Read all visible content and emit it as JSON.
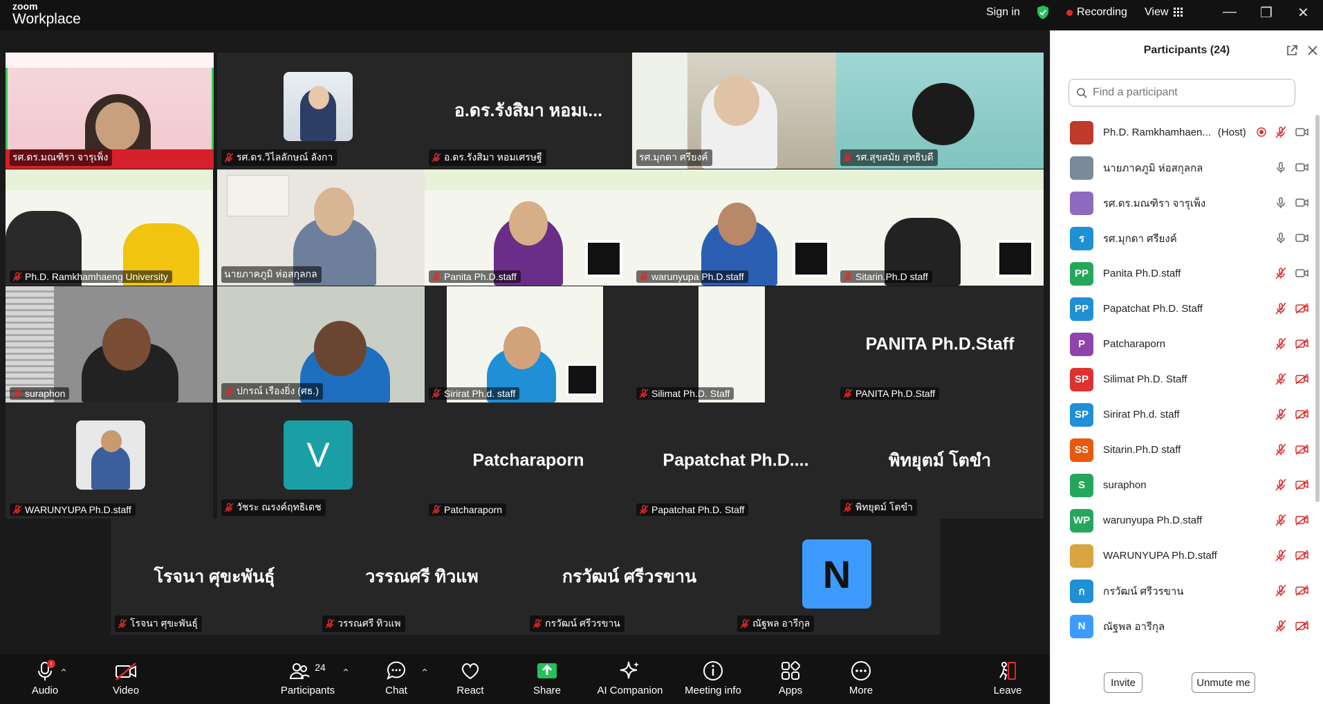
{
  "app": {
    "brand_top": "zoom",
    "brand_bottom": "Workplace"
  },
  "topbar": {
    "sign_in": "Sign in",
    "recording": "Recording",
    "view": "View"
  },
  "tiles": {
    "t1": "รศ.ดร.มณฑิรา จารุเพ็ง",
    "t2": "รศ.ดร.วิไลลักษณ์ ลังกา",
    "t3": "อ.ดร.รังสิมา หอมเศรษฐี",
    "t3_big": "อ.ดร.รังสิมา หอมเ...",
    "t4": "รศ.มุกดา ศรียงค์",
    "t5": "รศ.สุขสมัย สุทธิบดี",
    "t6": "Ph.D. Ramkhamhaeng University",
    "t7": "นายภาคภูมิ ห่อสกุลกล",
    "t8": "Panita Ph.D.staff",
    "t9": "warunyupa Ph.D.staff",
    "t10": "Sitarin.Ph.D staff",
    "t11": "suraphon",
    "t12": "ปกรณ์ เรืองยิ่ง (ศธ.)",
    "t13": "Sirirat Ph.d. staff",
    "t14": "Silimat Ph.D. Staff",
    "t15": "PANITA Ph.D.Staff",
    "t15_big": "PANITA Ph.D.Staff",
    "t16": "WARUNYUPA Ph.D.staff",
    "t17": "วัชระ ณรงค์ฤทธิเดช",
    "t17_avatar": "V",
    "t18": "Patcharaporn",
    "t18_big": "Patcharaporn",
    "t19": "Papatchat Ph.D. Staff",
    "t19_big": "Papatchat  Ph.D....",
    "t20": "พิทยุตม์ โตขำ",
    "t20_big": "พิทยุตม์ โตขำ",
    "t21": "โรจนา ศุขะพันธุ์",
    "t21_big": "โรจนา  ศุขะพันธุ์",
    "t22": "วรรณศรี ทิวแพ",
    "t22_big": "วรรณศรี  ทิวแพ",
    "t23": "กรวัฒน์ ศรีวรขาน",
    "t23_big": "กรวัฒน์ ศรีวรขาน",
    "t24": "ณัฐพล อารีกุล",
    "t24_avatar": "N"
  },
  "toolbar": {
    "audio": "Audio",
    "audio_badge": "!",
    "video": "Video",
    "participants": "Participants",
    "participants_count": "24",
    "chat": "Chat",
    "react": "React",
    "share": "Share",
    "ai": "AI Companion",
    "meeting_info": "Meeting info",
    "apps": "Apps",
    "more": "More",
    "leave": "Leave"
  },
  "panel": {
    "title": "Participants (24)",
    "search_placeholder": "Find a participant",
    "host_tag": "(Host)",
    "invite": "Invite",
    "unmute_me": "Unmute me",
    "participants": [
      {
        "name": "Ph.D. Ramkhamhaen...",
        "avatar": "",
        "color": "#c0392b"
      },
      {
        "name": "นายภาคภูมิ ห่อสกุลกล",
        "avatar": "",
        "color": "#7b8a99"
      },
      {
        "name": "รศ.ดร.มณฑิรา จารุเพ็ง",
        "avatar": "",
        "color": "#8e6bbf"
      },
      {
        "name": "รศ.มุกดา ศรียงค์",
        "avatar": "ร",
        "color": "#1f8fd6"
      },
      {
        "name": "Panita Ph.D.staff",
        "avatar": "PP",
        "color": "#26a65b"
      },
      {
        "name": "Papatchat Ph.D. Staff",
        "avatar": "PP",
        "color": "#1f8fd6"
      },
      {
        "name": "Patcharaporn",
        "avatar": "P",
        "color": "#8e44ad"
      },
      {
        "name": "Silimat Ph.D. Staff",
        "avatar": "SP",
        "color": "#e03131"
      },
      {
        "name": "Sirirat Ph.d. staff",
        "avatar": "SP",
        "color": "#1f8fd6"
      },
      {
        "name": "Sitarin.Ph.D staff",
        "avatar": "SS",
        "color": "#e8590c"
      },
      {
        "name": "suraphon",
        "avatar": "S",
        "color": "#26a65b"
      },
      {
        "name": "warunyupa Ph.D.staff",
        "avatar": "WP",
        "color": "#26a65b"
      },
      {
        "name": "WARUNYUPA Ph.D.staff",
        "avatar": "",
        "color": "#d9a441"
      },
      {
        "name": "กรวัฒน์ ศรีวรขาน",
        "avatar": "ก",
        "color": "#1f8fd6"
      },
      {
        "name": "ณัฐพล อารีกุล",
        "avatar": "N",
        "color": "#3d9bff"
      }
    ]
  },
  "colors": {
    "accent": "#0e72ed",
    "speaker": "#30d158",
    "mute_red": "#e02828",
    "record_red": "#e02828",
    "share_green": "#24c05a"
  }
}
